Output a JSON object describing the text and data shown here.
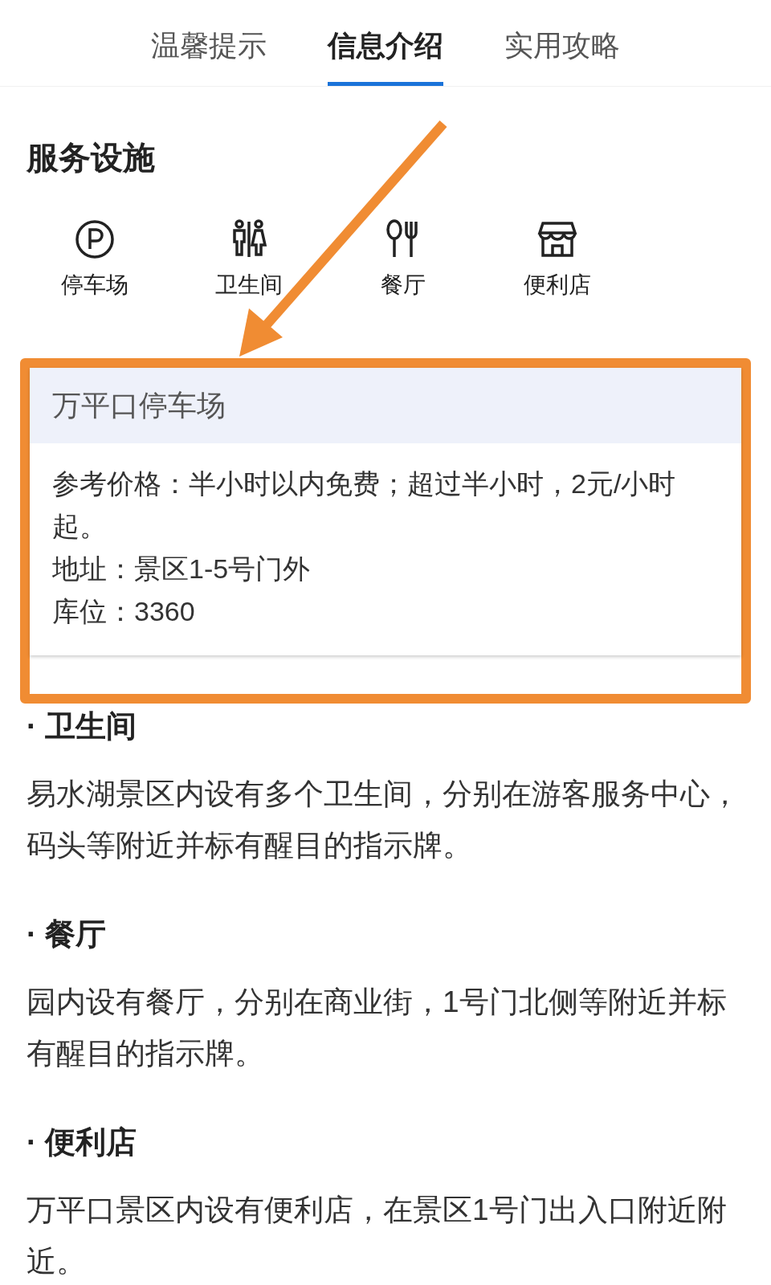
{
  "tabs": [
    {
      "label": "温馨提示",
      "selected": false
    },
    {
      "label": "信息介绍",
      "selected": true
    },
    {
      "label": "实用攻略",
      "selected": false
    }
  ],
  "section_title": "服务设施",
  "facilities": [
    {
      "label": "停车场",
      "kind": "parking"
    },
    {
      "label": "卫生间",
      "kind": "toilet"
    },
    {
      "label": "餐厅",
      "kind": "restaurant"
    },
    {
      "label": "便利店",
      "kind": "store"
    }
  ],
  "popup": {
    "title": "万平口停车场",
    "lines": [
      "参考价格：半小时以内免费；超过半小时，2元/小时起。",
      "地址：景区1-5号门外",
      "库位：3360"
    ]
  },
  "sections": [
    {
      "title": "· 卫生间",
      "body": "易水湖景区内设有多个卫生间，分别在游客服务中心，码头等附近并标有醒目的指示牌。"
    },
    {
      "title": "· 餐厅",
      "body": "园内设有餐厅，分别在商业街，1号门北侧等附近并标有醒目的指示牌。"
    },
    {
      "title": "· 便利店",
      "body": "万平口景区内设有便利店，在景区1号门出入口附近附近。"
    }
  ]
}
